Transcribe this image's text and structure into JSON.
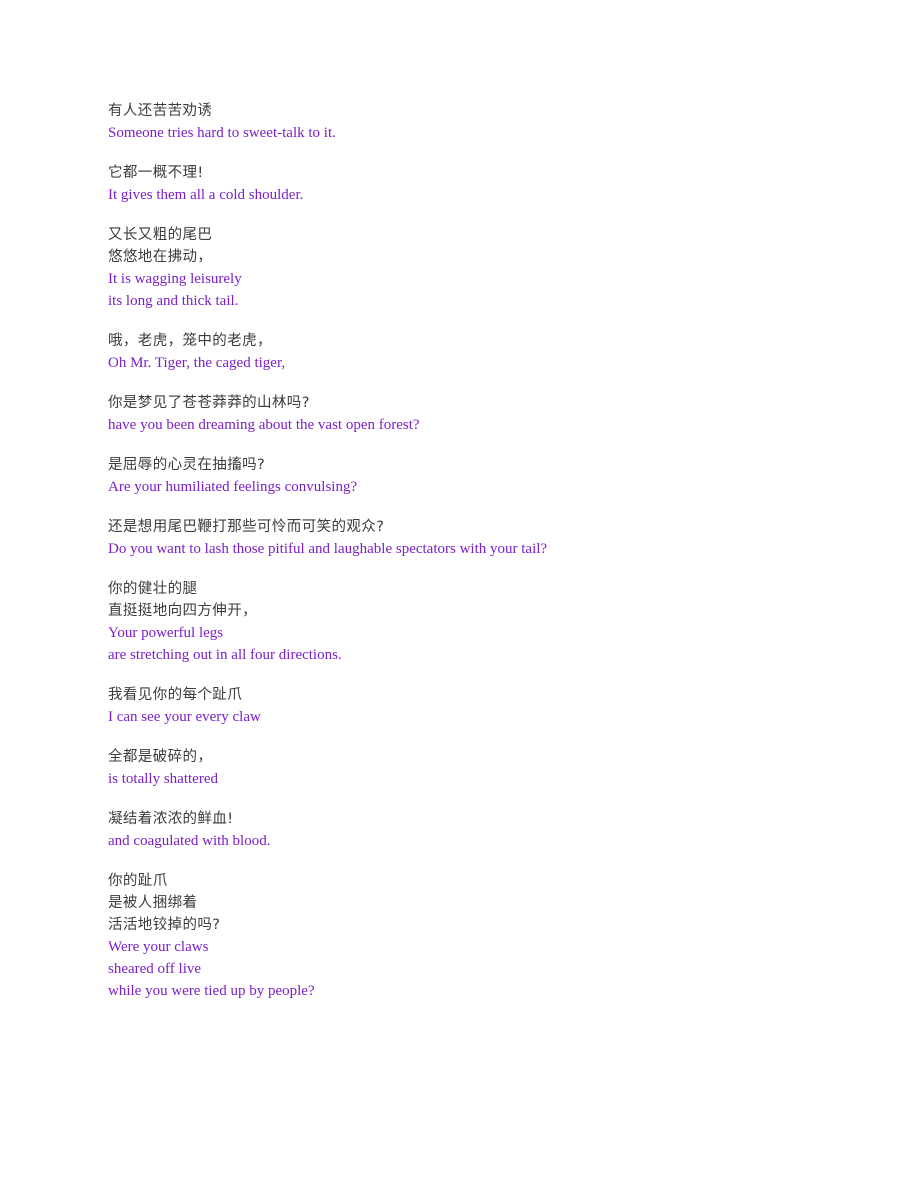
{
  "page": {
    "background_color": "#ffffff",
    "chinese_text_color": "#3c3c3c",
    "english_text_color": "#7b1fc7"
  },
  "stanzas": [
    {
      "lines": [
        {
          "lang": "zh",
          "text": "有人还苦苦劝诱"
        },
        {
          "lang": "en",
          "text": "Someone tries hard to sweet-talk to it."
        }
      ]
    },
    {
      "lines": [
        {
          "lang": "zh",
          "text": "它都一概不理!"
        },
        {
          "lang": "en",
          "text": "It gives them all a cold shoulder."
        }
      ]
    },
    {
      "lines": [
        {
          "lang": "zh",
          "text": "又长又粗的尾巴"
        },
        {
          "lang": "zh",
          "text": "悠悠地在拂动，"
        },
        {
          "lang": "en",
          "text": "It is wagging leisurely"
        },
        {
          "lang": "en",
          "text": "its long and thick tail."
        }
      ]
    },
    {
      "lines": [
        {
          "lang": "zh",
          "text": "哦，老虎，笼中的老虎，"
        },
        {
          "lang": "en",
          "text": "Oh Mr. Tiger, the caged tiger,"
        }
      ]
    },
    {
      "lines": [
        {
          "lang": "zh",
          "text": "你是梦见了苍苍莽莽的山林吗?"
        },
        {
          "lang": "en",
          "text": "have you been dreaming about the vast open forest?"
        }
      ]
    },
    {
      "lines": [
        {
          "lang": "zh",
          "text": "是屈辱的心灵在抽搐吗?"
        },
        {
          "lang": "en",
          "text": "Are your humiliated feelings convulsing?"
        }
      ]
    },
    {
      "lines": [
        {
          "lang": "zh",
          "text": "还是想用尾巴鞭打那些可怜而可笑的观众?"
        },
        {
          "lang": "en",
          "text": "Do you want to lash those pitiful and laughable spectators with your tail?"
        }
      ]
    },
    {
      "lines": [
        {
          "lang": "zh",
          "text": "你的健壮的腿"
        },
        {
          "lang": "zh",
          "text": "直挺挺地向四方伸开，"
        },
        {
          "lang": "en",
          "text": "Your powerful legs"
        },
        {
          "lang": "en",
          "text": "are stretching out in all four directions."
        }
      ]
    },
    {
      "lines": [
        {
          "lang": "zh",
          "text": "我看见你的每个趾爪"
        },
        {
          "lang": "en",
          "text": "I can see your every claw"
        }
      ]
    },
    {
      "lines": [
        {
          "lang": "zh",
          "text": "全都是破碎的，"
        },
        {
          "lang": "en",
          "text": "is totally shattered"
        }
      ]
    },
    {
      "lines": [
        {
          "lang": "zh",
          "text": "凝结着浓浓的鲜血!"
        },
        {
          "lang": "en",
          "text": "and coagulated with blood."
        }
      ]
    },
    {
      "lines": [
        {
          "lang": "zh",
          "text": "你的趾爪"
        },
        {
          "lang": "zh",
          "text": "是被人捆绑着"
        },
        {
          "lang": "zh",
          "text": "活活地铰掉的吗?"
        },
        {
          "lang": "en",
          "text": "Were your claws"
        },
        {
          "lang": "en",
          "text": "sheared off live"
        },
        {
          "lang": "en",
          "text": "while you were tied up by people?"
        }
      ]
    }
  ]
}
